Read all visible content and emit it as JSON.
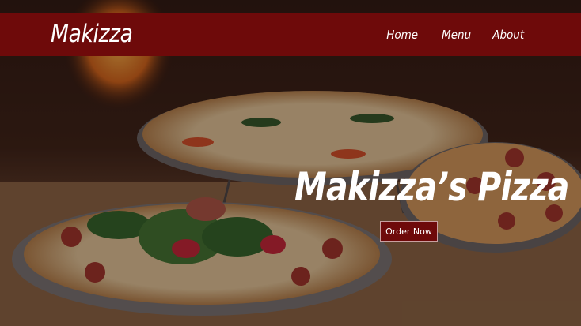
{
  "brand": {
    "name": "Makizza"
  },
  "nav": {
    "items": [
      {
        "label": "Home"
      },
      {
        "label": "Menu"
      },
      {
        "label": "About"
      }
    ]
  },
  "hero": {
    "title": "Makizza’s Pizza",
    "cta_label": "Order Now",
    "image": "pizza-table-photo"
  },
  "colors": {
    "navbar_bg": "#6e0a0a",
    "button_bg": "#6e0a0a",
    "text": "#ffffff"
  }
}
